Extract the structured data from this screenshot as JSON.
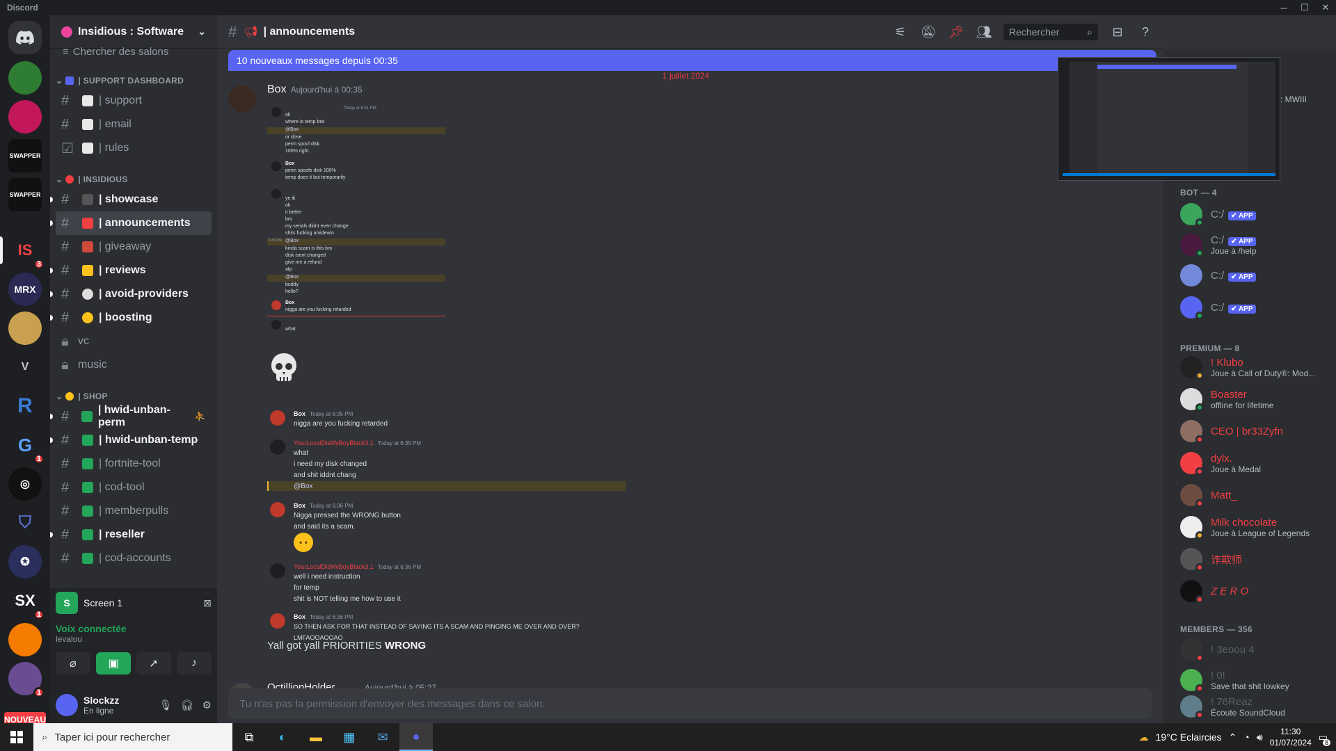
{
  "window": {
    "app_title": "Discord",
    "minimize": "─",
    "maximize": "☐",
    "close": "✕"
  },
  "servers": {
    "nouveau_label": "NOUVEAU",
    "badges": [
      "3",
      "1",
      "1",
      "1",
      "1"
    ],
    "labels": [
      "IS",
      "MRX",
      "R",
      "SX"
    ]
  },
  "guild": {
    "name": "Insidious : Software",
    "search_channels": "Chercher des salons"
  },
  "categories": {
    "support": "| SUPPORT DASHBOARD",
    "insidious": "| INSIDIOUS",
    "shop": "| SHOP"
  },
  "channels": {
    "support": [
      {
        "name": "| support",
        "unread": false
      },
      {
        "name": "| email",
        "unread": false
      },
      {
        "name": "| rules",
        "unread": false
      }
    ],
    "insidious": [
      {
        "name": "| showcase",
        "unread": true
      },
      {
        "name": "| announcements",
        "unread": true
      },
      {
        "name": "| giveaway",
        "unread": false
      },
      {
        "name": "| reviews",
        "unread": true
      },
      {
        "name": "| avoid-providers",
        "unread": true
      },
      {
        "name": "| boosting",
        "unread": true
      },
      {
        "name": "vc",
        "unread": false
      },
      {
        "name": "music",
        "unread": false
      }
    ],
    "shop": [
      {
        "name": "| hwid-unban-perm",
        "unread": true
      },
      {
        "name": "| hwid-unban-temp",
        "unread": true
      },
      {
        "name": "| fortnite-tool",
        "unread": false
      },
      {
        "name": "| cod-tool",
        "unread": false
      },
      {
        "name": "| memberpulls",
        "unread": false
      },
      {
        "name": "| reseller",
        "unread": true
      },
      {
        "name": "| cod-accounts",
        "unread": false
      }
    ]
  },
  "stream": {
    "screen_label": "Screen 1",
    "voice_connected": "Voix connectée",
    "voice_channel": "levalou"
  },
  "user": {
    "name": "Slockzz",
    "status": "En ligne"
  },
  "header": {
    "channel": "| announcements",
    "search_placeholder": "Rechercher"
  },
  "new_messages_bar": {
    "text": "10 nouveaux messages depuis 00:35",
    "mark": "M"
  },
  "date_divider": "1 juillet 2024",
  "message": {
    "author": "Box",
    "timestamp": "Aujourd'hui à 00:35",
    "screenshot1": {
      "lines": [
        "ok",
        "where is temp btw",
        "@Box",
        "or dose",
        "perm spoof disk",
        "100% right."
      ],
      "box_lines": [
        "perm spoofs disk 100%",
        "temp does it but temporarily"
      ],
      "lines2": [
        "ye ik",
        "ok",
        "it better",
        "bro",
        "my serials didnt even change",
        "shits fucking amidewin"
      ],
      "lines3": [
        "@Box",
        "kinda scam is this bro",
        "disk isent changed",
        "give me a refund",
        "atp",
        "@Box",
        "buddy",
        "hello?"
      ],
      "box_reply": "nigga are you fucking retarded",
      "what": "what",
      "box_name": "Box",
      "ts1": "Today at 6:31 PM",
      "ts_side": "6:35 PM"
    },
    "screenshot2": {
      "box_name": "Box",
      "ts_a": "Today at 6:35 PM",
      "line_a": "nigga are you fucking retarded",
      "user_name": "YourLocalDisMyBoyBlack3.1",
      "ts_b": "Today at 6:35 PM",
      "lines_b": [
        "what",
        "i need my disk changed",
        "and shit iddnt chang"
      ],
      "mention": "@Box",
      "ts_c": "Today at 6:36 PM",
      "lines_c": [
        "Nigga pressed the WRONG button",
        "and said its a scam."
      ],
      "ts_d": "Today at 6:36 PM",
      "lines_d": [
        "well i need instruction",
        "for temp",
        "shit is NOT telling me how to use it"
      ],
      "ts_e": "Today at 6:36 PM",
      "lines_e": [
        "SO THEN ASK FOR THAT INSTEAD OF SAYING ITS A SCAM AND PINGING ME OVER AND OVER?",
        "LMFAOOAOOAO"
      ]
    },
    "text_plain": "Yall got yall PRIORITIES ",
    "text_bold": "WRONG"
  },
  "next_message": {
    "author": "OctillionHolder",
    "timestamp": "Aujourd'hui à 05:27"
  },
  "input": {
    "placeholder": "Tu n'as pas la permission d'envoyer des messages dans ce salon."
  },
  "members": {
    "top_status": ": MWIII",
    "bot_header": "BOT — 4",
    "bots": [
      {
        "name": "C:/",
        "tag": "✔ APP",
        "status": "",
        "color": "#3ba55c"
      },
      {
        "name": "C:/",
        "tag": "✔ APP",
        "status": "Joue à /help",
        "color": "#4a1b3f"
      },
      {
        "name": "C:/",
        "tag": "✔ APP",
        "status": "",
        "color": "#7289da"
      },
      {
        "name": "C:/",
        "tag": "✔ APP",
        "status": "",
        "color": "#5865f2"
      }
    ],
    "premium_header": "PREMIUM — 8",
    "premium": [
      {
        "name": "! Klubo",
        "status": "Joue à Call of Duty®: Mod...",
        "color": "#f23f43",
        "dot": "#f0b232"
      },
      {
        "name": "Boaster",
        "status": "offline for lifetime",
        "color": "#f23f43",
        "dot": "#23a55a"
      },
      {
        "name": "CEO | br33Zyfn",
        "status": "",
        "color": "#f23f43",
        "dot": "#f23f43"
      },
      {
        "name": "dylx.",
        "status": "Joue à Medal",
        "color": "#f23f43",
        "dot": "#f23f43"
      },
      {
        "name": "Matt_",
        "status": "",
        "color": "#f23f43",
        "dot": "#f23f43"
      },
      {
        "name": "Milk chocolate",
        "status": "Joue à League of Legends",
        "color": "#f23f43",
        "dot": "#f0b232"
      },
      {
        "name": "诈欺师",
        "status": "",
        "color": "#f23f43",
        "dot": "#f23f43"
      },
      {
        "name": "Z E R O",
        "status": "",
        "color": "#f23f43",
        "dot": "#f23f43"
      }
    ],
    "members_header": "MEMBERS — 356",
    "members": [
      {
        "name": "! 3eoou 4",
        "status": ""
      },
      {
        "name": "! 0!",
        "status": "Save that shit lowkey"
      },
      {
        "name": "! 76Reaz",
        "status": "Écoute SoundCloud"
      }
    ]
  },
  "taskbar": {
    "search": "Taper ici pour rechercher",
    "weather": "19°C  Eclaircies",
    "time": "11:30",
    "date": "01/07/2024",
    "notif": "8"
  },
  "colors": {
    "accent": "#5865f2",
    "online": "#23a55a",
    "dnd": "#f23f43"
  }
}
